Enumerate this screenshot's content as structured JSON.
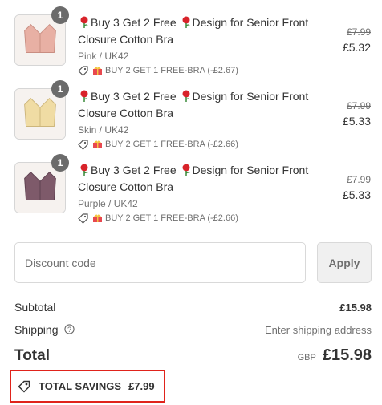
{
  "line_items": [
    {
      "quantity": "1",
      "title_part1": "Buy 3 Get 2 Free",
      "title_part2": "Design for Senior Front Closure Cotton Bra",
      "variant": "Pink / UK42",
      "discount_text": "BUY 2 GET 1 FREE-BRA (-£2.67)",
      "compare_price": "£7.99",
      "price": "£5.32",
      "color": "#e8b0a4"
    },
    {
      "quantity": "1",
      "title_part1": "Buy 3 Get 2 Free",
      "title_part2": "Design for Senior Front Closure Cotton Bra",
      "variant": "Skin / UK42",
      "discount_text": "BUY 2 GET 1 FREE-BRA (-£2.66)",
      "compare_price": "£7.99",
      "price": "£5.33",
      "color": "#f0dca4"
    },
    {
      "quantity": "1",
      "title_part1": "Buy 3 Get 2 Free",
      "title_part2": "Design for Senior Front Closure Cotton Bra",
      "variant": "Purple / UK42",
      "discount_text": "BUY 2 GET 1 FREE-BRA (-£2.66)",
      "compare_price": "£7.99",
      "price": "£5.33",
      "color": "#7e5a6a"
    }
  ],
  "discount": {
    "placeholder": "Discount code",
    "apply_label": "Apply"
  },
  "summary": {
    "subtotal_label": "Subtotal",
    "subtotal_value": "£15.98",
    "shipping_label": "Shipping",
    "shipping_value": "Enter shipping address",
    "total_label": "Total",
    "currency": "GBP",
    "total_value": "£15.98"
  },
  "savings": {
    "label": "TOTAL SAVINGS",
    "value": "£7.99",
    "highlight_color": "#e0231b"
  },
  "icons": {
    "rose": "rose-icon",
    "tag": "tag-icon",
    "gift": "gift-icon",
    "info": "info-icon"
  }
}
